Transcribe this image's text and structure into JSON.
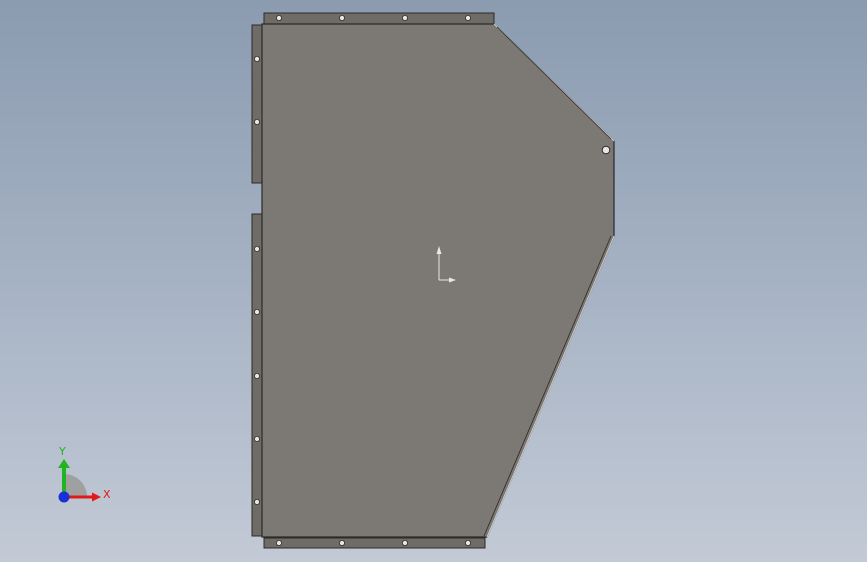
{
  "view": {
    "background_top": "#8b9bb0",
    "background_bottom": "#c3cad6",
    "part_fill": "#7c7873",
    "flange_fill": "#6f6b66",
    "edge_color": "#2b2a28"
  },
  "triad": {
    "x_label": "X",
    "y_label": "Y",
    "x_color": "#e01919",
    "y_color": "#21b321",
    "z_color": "#1a2fd6"
  },
  "icons": [
    "origin-marker-icon",
    "axis-triad-icon"
  ]
}
